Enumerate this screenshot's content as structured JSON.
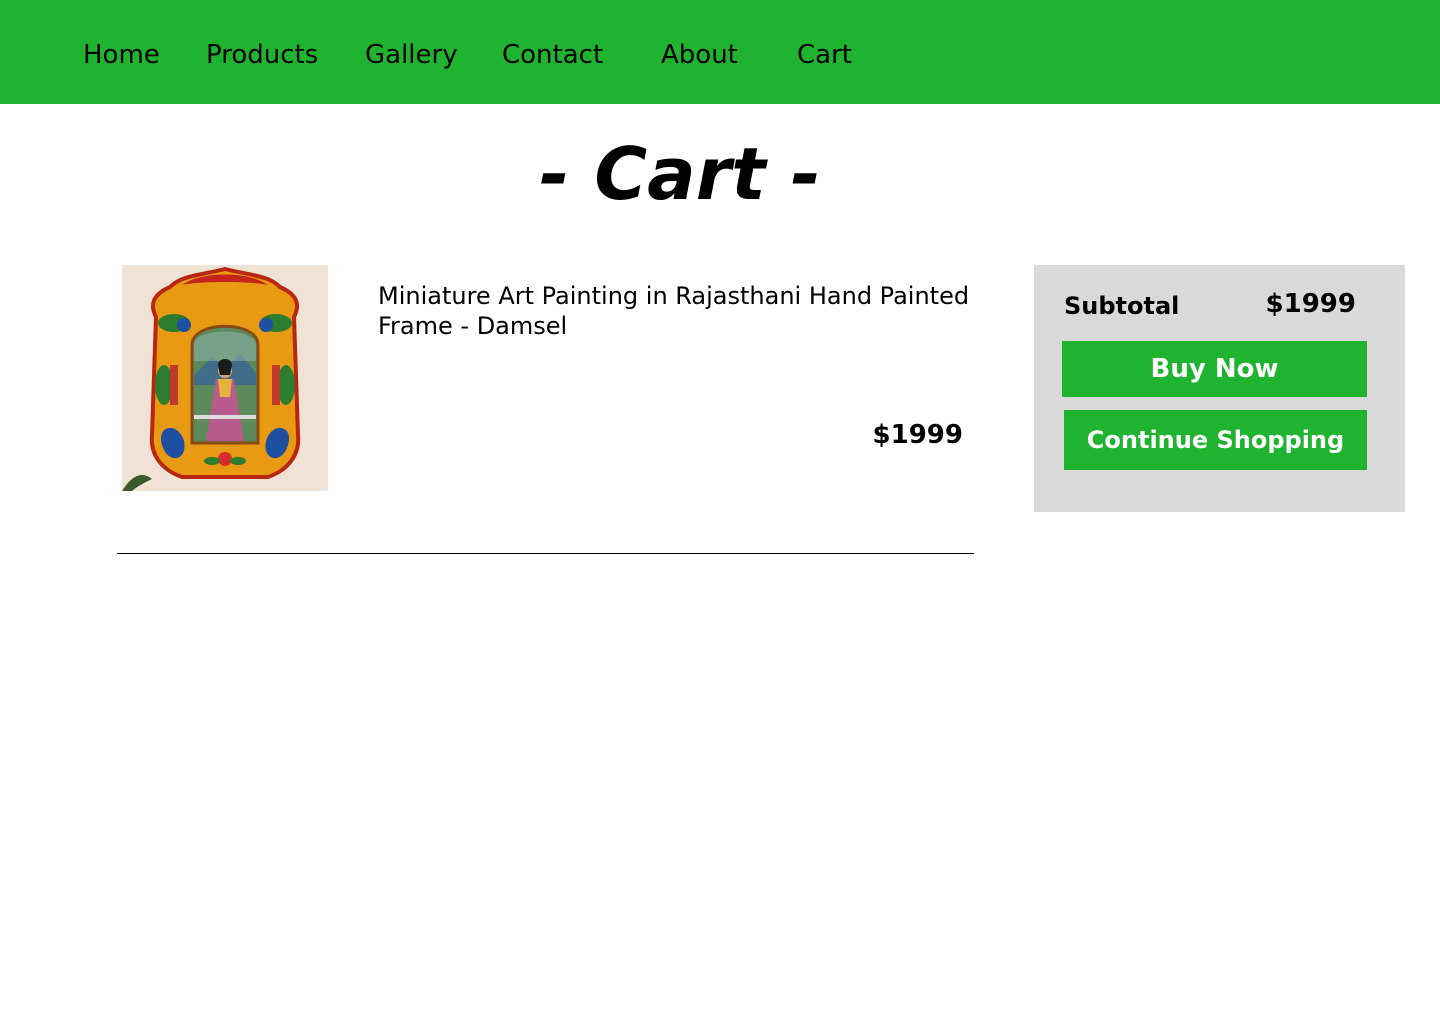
{
  "nav": {
    "items": [
      {
        "label": "Home"
      },
      {
        "label": "Products"
      },
      {
        "label": "Gallery"
      },
      {
        "label": "Contact"
      },
      {
        "label": "About"
      },
      {
        "label": "Cart"
      }
    ]
  },
  "page": {
    "title": "- Cart -"
  },
  "cart": {
    "items": [
      {
        "name": "Miniature Art Painting in Rajasthani Hand Painted Frame - Damsel",
        "price": "$1999",
        "image": "rajasthani-miniature-painting-image"
      }
    ]
  },
  "summary": {
    "subtotal_label": "Subtotal",
    "subtotal_value": "$1999",
    "buy_label": "Buy Now",
    "continue_label": "Continue Shopping"
  },
  "colors": {
    "brand_green": "#1fb32f",
    "panel_gray": "#d9d9d9"
  }
}
